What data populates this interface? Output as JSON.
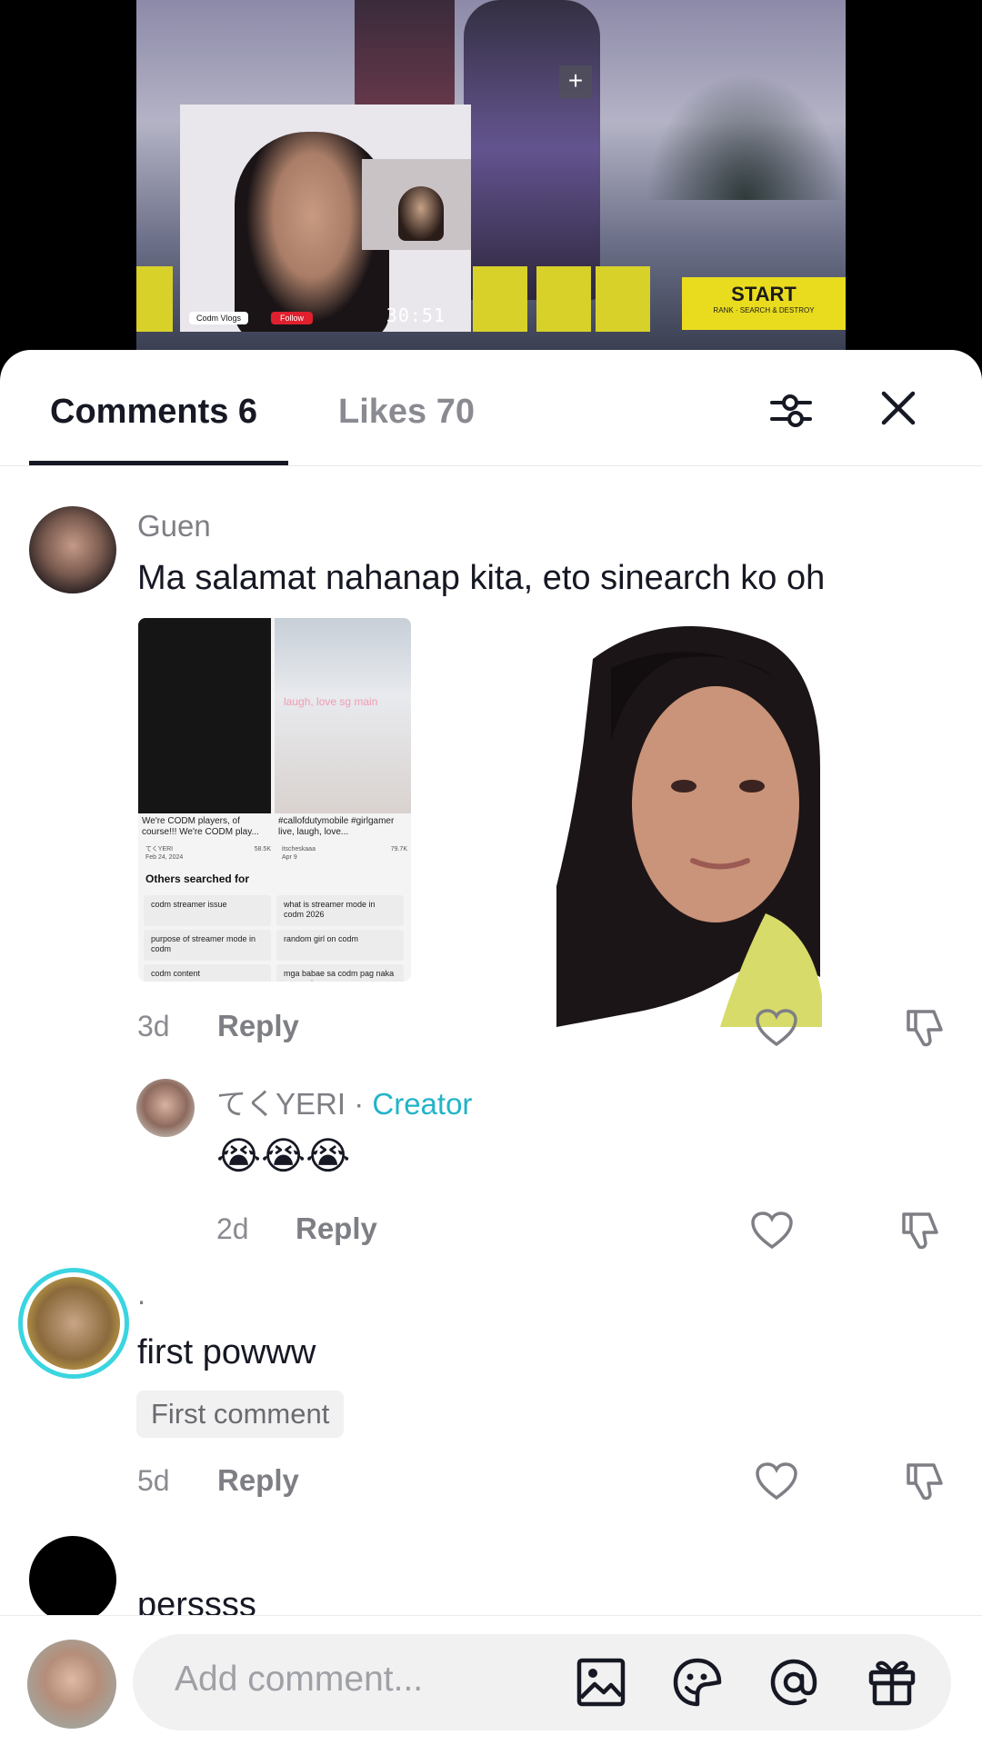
{
  "video": {
    "timer": "30:51",
    "start_label": "START",
    "start_sub": "RANK · SEARCH & DESTROY",
    "streamer_tag": "Codm Vlogs",
    "follow_label": "Follow"
  },
  "tabs": {
    "comments": "Comments 6",
    "likes": "Likes 70"
  },
  "comments": [
    {
      "user": "Guen",
      "text": "Ma salamat nahanap kita, eto sinearch ko oh",
      "age": "3d",
      "reply": "Reply",
      "screenshot": {
        "left_caption": "We're CODM players, of course!!! We're CODM play...",
        "right_caption": "#callofdutymobile #girlgamer live, laugh, love...",
        "overlay_text": "laugh, love sg main",
        "left_user": "てくYERI",
        "left_date": "Feb 24, 2024",
        "left_likes": "58.5K",
        "right_user": "itscheskaaa",
        "right_date": "Apr 9",
        "right_likes": "79.7K",
        "others_heading": "Others searched for",
        "chips": [
          "codm streamer issue",
          "what is streamer mode in codm 2026",
          "purpose of streamer mode in codm",
          "random girl on codm",
          "codm content",
          "mga babae sa codm pag naka open mic"
        ]
      }
    },
    {
      "user": "てくYERI",
      "separator": " · ",
      "creator_label": "Creator",
      "text": "😭😭😭",
      "age": "2d",
      "reply": "Reply"
    },
    {
      "user": ".",
      "text": "first powww",
      "badge": "First comment",
      "age": "5d",
      "reply": "Reply"
    },
    {
      "text": "perssss"
    }
  ],
  "composer": {
    "placeholder": "Add comment..."
  }
}
